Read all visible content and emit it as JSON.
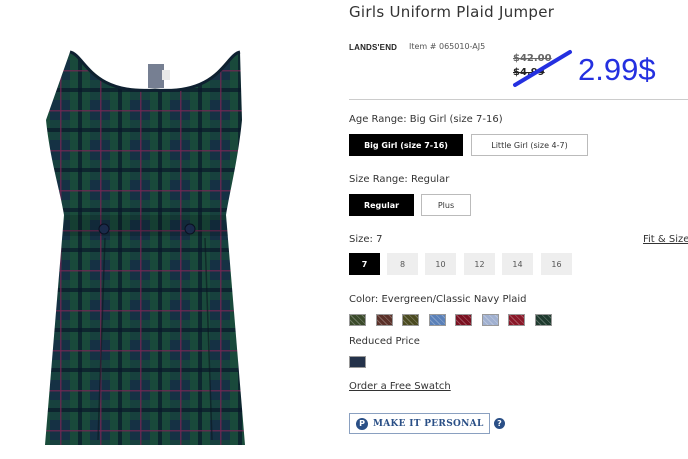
{
  "product": {
    "title": "Girls Uniform Plaid Jumper",
    "brand": "LANDS'END",
    "item_number": "Item # 065010-AJ5",
    "price_original": "$42.00",
    "price_sale": "$4.99",
    "price_new": "2.99$",
    "annotation_color": "#2430e0"
  },
  "age_range": {
    "label": "Age Range: Big Girl (size 7-16)",
    "options": [
      "Big Girl (size 7-16)",
      "Little Girl (size 4-7)"
    ],
    "selected_index": 0
  },
  "size_range": {
    "label": "Size Range: Regular",
    "options": [
      "Regular",
      "Plus"
    ],
    "selected_index": 0
  },
  "size": {
    "label": "Size: 7",
    "fit_link": "Fit & Size",
    "options": [
      "7",
      "8",
      "10",
      "12",
      "14",
      "16"
    ],
    "selected_index": 0
  },
  "color": {
    "label": "Color: Evergreen/Classic Navy Plaid",
    "swatch_colors": [
      "#3a4a2a",
      "#5a3028",
      "#4a4a20",
      "#5a80b8",
      "#7a1020",
      "#a0b0d0",
      "#8a1828",
      "#1e3a2e"
    ],
    "reduced_label": "Reduced Price",
    "reduced_swatch_color": "#24324a",
    "swatch_link": "Order a Free Swatch"
  },
  "personalize": {
    "icon_letter": "P",
    "label": "MAKE IT PERSONAL",
    "help": "?"
  }
}
